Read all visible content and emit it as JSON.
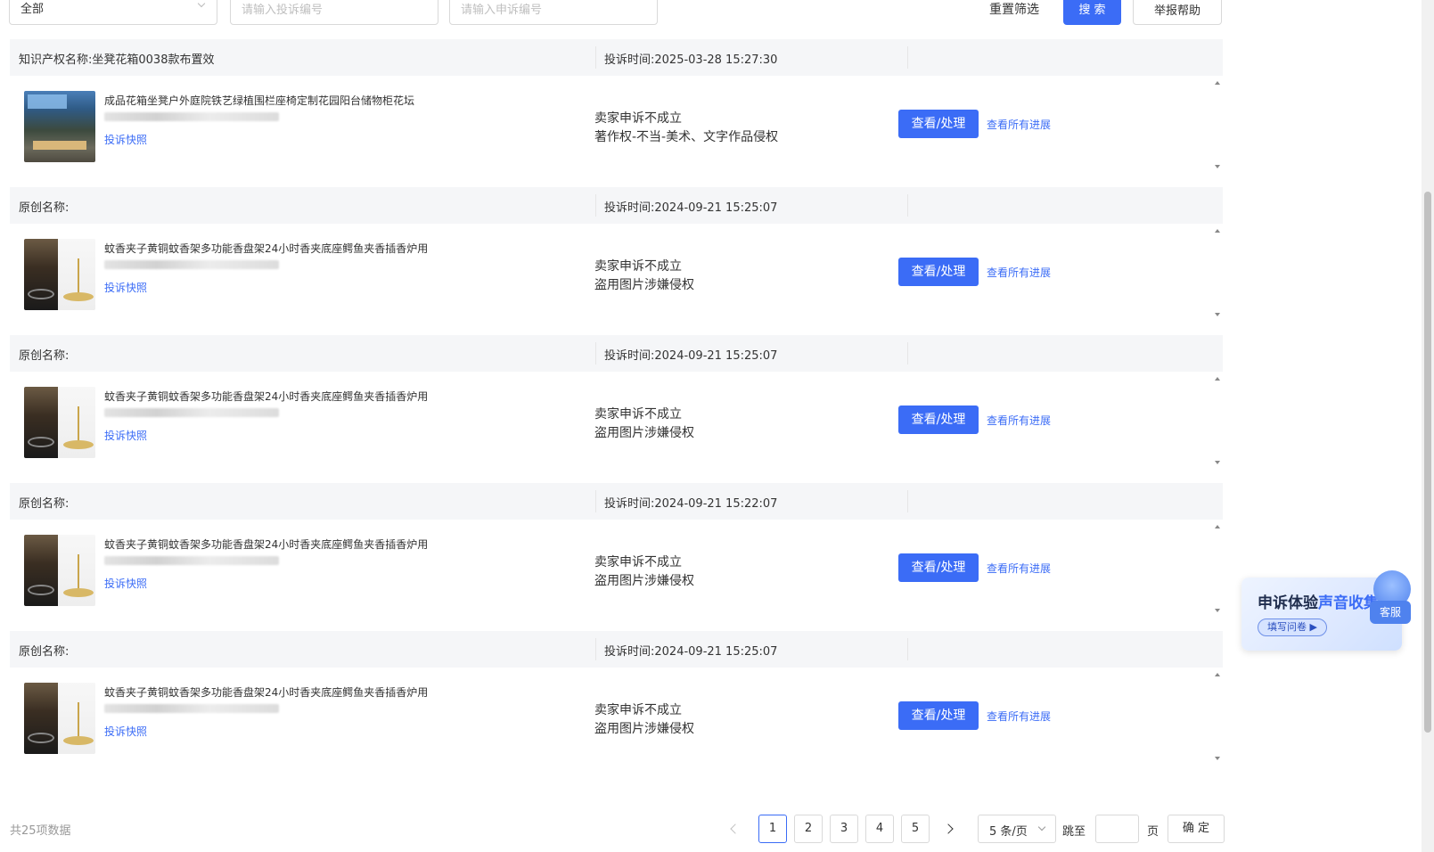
{
  "filters": {
    "type_select": "全部",
    "complaint_no_placeholder": "请输入投诉编号",
    "appeal_no_placeholder": "请输入申诉编号",
    "reset_label": "重置筛选",
    "search_label": "搜 索",
    "export_label": "举报帮助"
  },
  "records": [
    {
      "name": "知识产权名称:坐凳花箱0038款布置效",
      "time": "投诉时间:2025-03-28 15:27:30",
      "product_title": "成品花箱坐凳户外庭院铁艺绿植围栏座椅定制花园阳台储物柜花坛",
      "snapshot": "投诉快照",
      "status": "卖家申诉不成立",
      "reason": "著作权-不当-美术、文字作品侵权",
      "view_btn": "查看/处理",
      "progress_link": "查看所有进展"
    },
    {
      "name": "原创名称:",
      "time": "投诉时间:2024-09-21 15:25:07",
      "product_title": "蚊香夹子黄铜蚊香架多功能香盘架24小时香夹底座鳄鱼夹香插香炉用",
      "snapshot": "投诉快照",
      "status": "卖家申诉不成立",
      "reason": "盗用图片涉嫌侵权",
      "view_btn": "查看/处理",
      "progress_link": "查看所有进展"
    },
    {
      "name": "原创名称:",
      "time": "投诉时间:2024-09-21 15:25:07",
      "product_title": "蚊香夹子黄铜蚊香架多功能香盘架24小时香夹底座鳄鱼夹香插香炉用",
      "snapshot": "投诉快照",
      "status": "卖家申诉不成立",
      "reason": "盗用图片涉嫌侵权",
      "view_btn": "查看/处理",
      "progress_link": "查看所有进展"
    },
    {
      "name": "原创名称:",
      "time": "投诉时间:2024-09-21 15:22:07",
      "product_title": "蚊香夹子黄铜蚊香架多功能香盘架24小时香夹底座鳄鱼夹香插香炉用",
      "snapshot": "投诉快照",
      "status": "卖家申诉不成立",
      "reason": "盗用图片涉嫌侵权",
      "view_btn": "查看/处理",
      "progress_link": "查看所有进展"
    },
    {
      "name": "原创名称:",
      "time": "投诉时间:2024-09-21 15:25:07",
      "product_title": "蚊香夹子黄铜蚊香架多功能香盘架24小时香夹底座鳄鱼夹香插香炉用",
      "snapshot": "投诉快照",
      "status": "卖家申诉不成立",
      "reason": "盗用图片涉嫌侵权",
      "view_btn": "查看/处理",
      "progress_link": "查看所有进展"
    }
  ],
  "pagination": {
    "total": "共25项数据",
    "pages": [
      "1",
      "2",
      "3",
      "4",
      "5"
    ],
    "current": "1",
    "page_size": "5 条/页",
    "jump_label": "跳至",
    "page_unit": "页",
    "confirm": "确 定"
  },
  "survey": {
    "title_main": "申诉体验",
    "title_accent": "声音收集",
    "fill_label": "填写问卷 ▶",
    "service_label": "客服"
  },
  "colors": {
    "primary": "#3b6cf6",
    "header_bg": "#f5f6f8"
  }
}
